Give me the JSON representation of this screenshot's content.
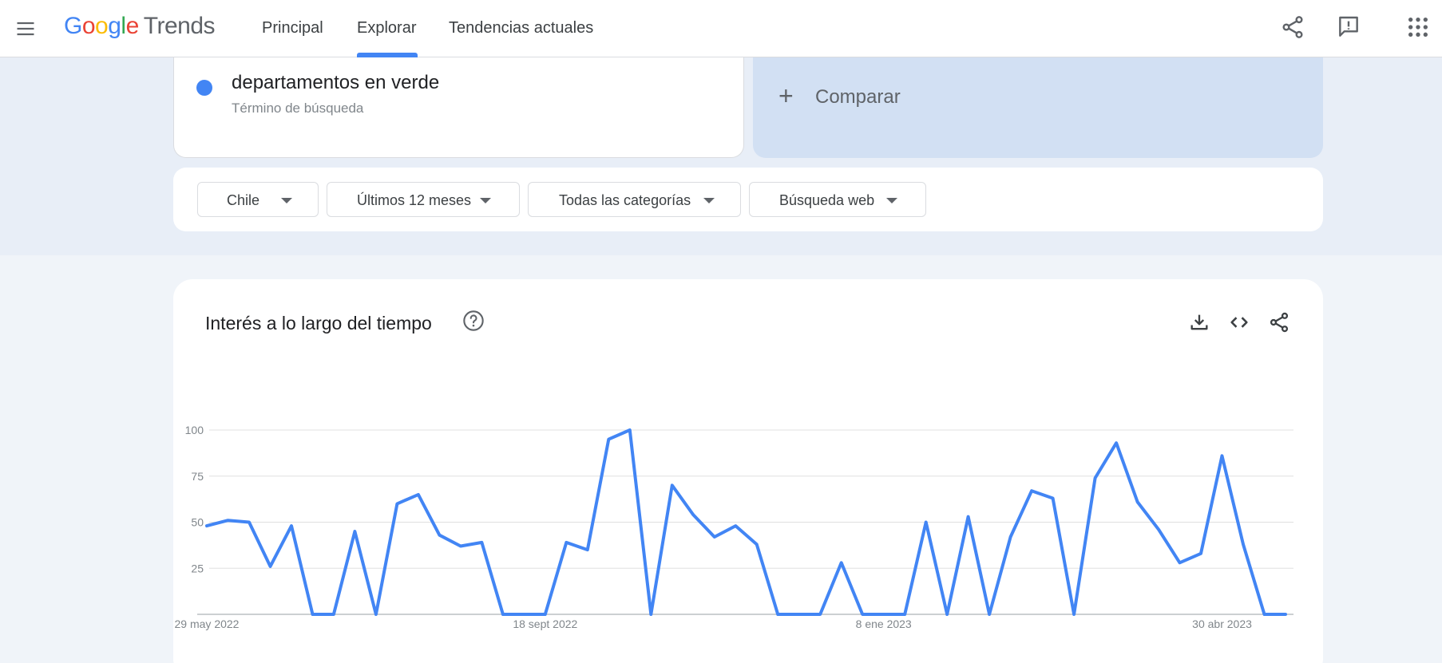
{
  "header": {
    "logo_google": [
      "G",
      "o",
      "o",
      "g",
      "l",
      "e"
    ],
    "logo_product": "Trends",
    "tabs": [
      {
        "label": "Principal"
      },
      {
        "label": "Explorar"
      },
      {
        "label": "Tendencias actuales"
      }
    ],
    "active_tab": "Explorar"
  },
  "search_term": {
    "name": "departamentos en verde",
    "type": "Término de búsqueda",
    "color": "#4285f4"
  },
  "compare": {
    "plus": "+",
    "label": "Comparar"
  },
  "filters": [
    {
      "label": "Chile"
    },
    {
      "label": "Últimos 12 meses"
    },
    {
      "label": "Todas las categorías"
    },
    {
      "label": "Búsqueda web"
    }
  ],
  "chart_card": {
    "title": "Interés a lo largo del tiempo"
  },
  "icons": [
    "menu-icon",
    "share-icon",
    "feedback-icon",
    "apps-icon",
    "help-icon",
    "download-icon",
    "embed-icon",
    "share-icon"
  ],
  "accent_color": "#4285f4",
  "chart_data": {
    "type": "line",
    "title": "Interés a lo largo del tiempo",
    "xlabel": "",
    "ylabel": "",
    "ylim": [
      0,
      100
    ],
    "y_ticks": [
      "25",
      "50",
      "75",
      "100"
    ],
    "x_tick_labels": [
      {
        "label": "29 may 2022",
        "index": 0
      },
      {
        "label": "18 sept 2022",
        "index": 16
      },
      {
        "label": "8 ene 2023",
        "index": 32
      },
      {
        "label": "30 abr 2023",
        "index": 48
      }
    ],
    "grid": true,
    "series": [
      {
        "name": "departamentos en verde",
        "color": "#4285f4",
        "values": [
          48,
          51,
          50,
          26,
          48,
          0,
          0,
          45,
          0,
          60,
          65,
          43,
          37,
          39,
          0,
          0,
          0,
          39,
          35,
          95,
          100,
          0,
          70,
          54,
          42,
          48,
          38,
          0,
          0,
          0,
          28,
          0,
          0,
          0,
          50,
          0,
          53,
          0,
          42,
          67,
          63,
          0,
          74,
          93,
          61,
          46,
          28,
          33,
          86,
          38,
          0,
          0
        ]
      }
    ]
  }
}
